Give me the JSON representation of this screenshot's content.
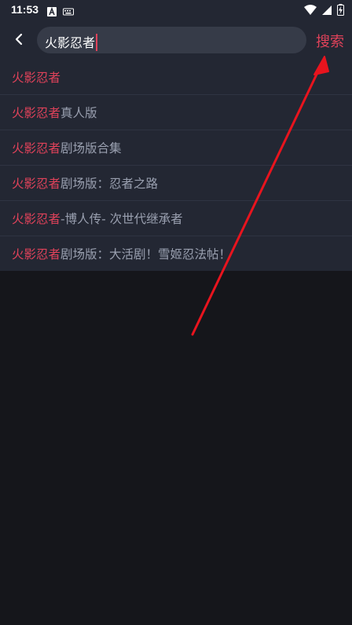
{
  "status_bar": {
    "time": "11:53",
    "left_icons": [
      "a-notification-icon",
      "keyboard-icon"
    ],
    "right_icons": [
      "wifi-icon",
      "signal-icon",
      "battery-charging-icon"
    ]
  },
  "header": {
    "search_query": "火影忍者",
    "search_button_label": "搜索"
  },
  "suggestions": [
    {
      "highlight": "火影忍者",
      "rest": ""
    },
    {
      "highlight": "火影忍者",
      "rest": "真人版"
    },
    {
      "highlight": "火影忍者",
      "rest": "剧场版合集"
    },
    {
      "highlight": "火影忍者",
      "rest": "剧场版：忍者之路"
    },
    {
      "highlight": "火影忍者",
      "rest": " -博人传- 次世代继承者"
    },
    {
      "highlight": "火影忍者",
      "rest": "剧场版：大活剧！雪姬忍法帖！"
    }
  ],
  "colors": {
    "accent": "#e0425a",
    "header_bg": "#232733",
    "page_bg": "#15161b",
    "annotation_arrow": "#e8141e"
  }
}
